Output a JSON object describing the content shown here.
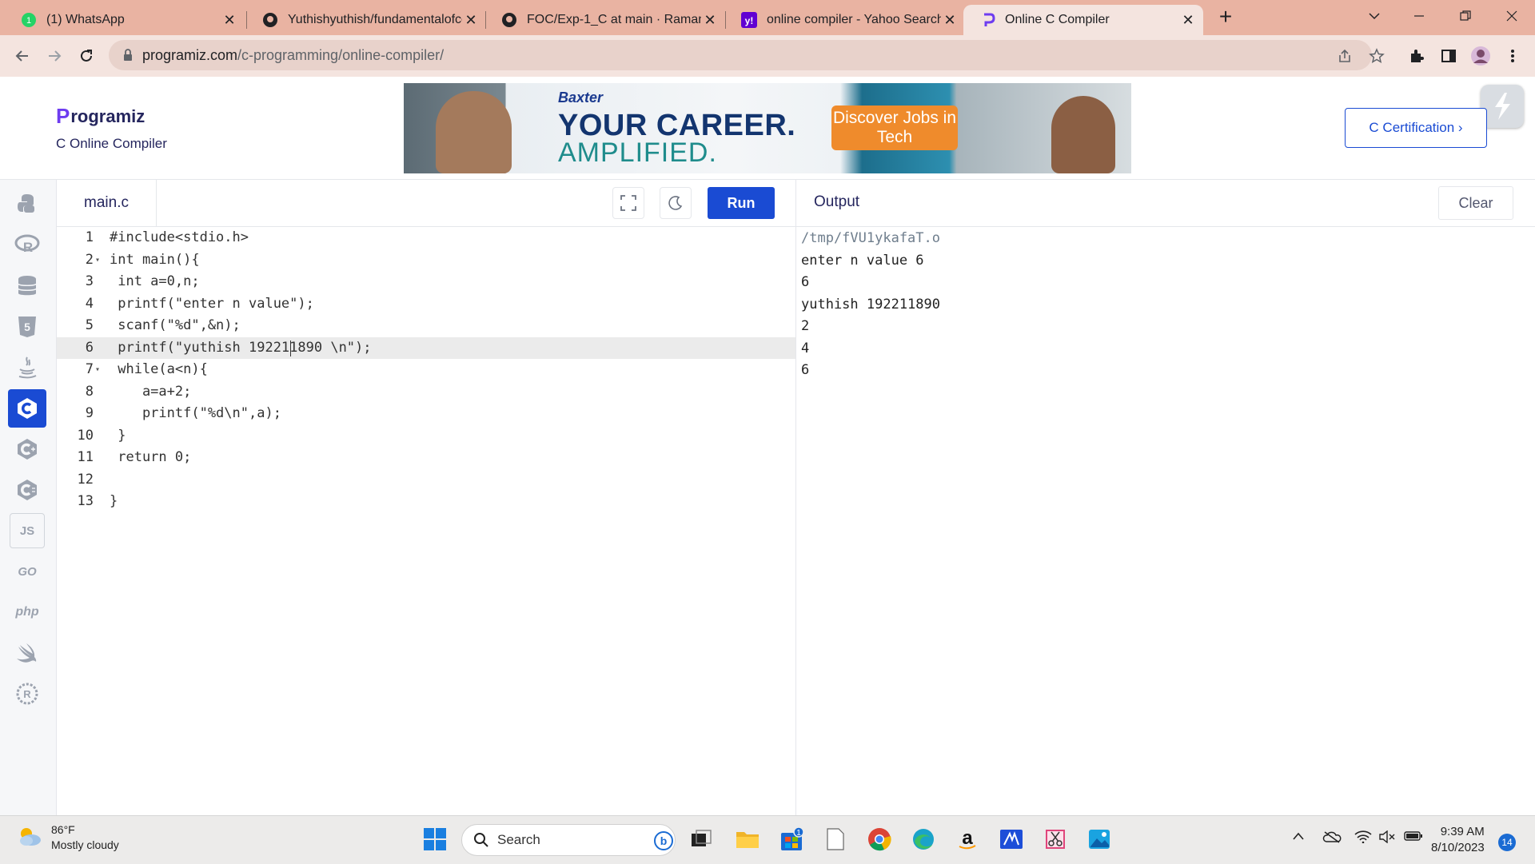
{
  "browser": {
    "tabs": [
      {
        "title": "(1) WhatsApp",
        "icon": "whatsapp-icon"
      },
      {
        "title": "Yuthishyuthish/fundamentalofcor",
        "icon": "github-icon"
      },
      {
        "title": "FOC/Exp-1_C at main · Ramanee:",
        "icon": "github-icon"
      },
      {
        "title": "online compiler - Yahoo Search R",
        "icon": "yahoo-icon"
      },
      {
        "title": "Online C Compiler",
        "icon": "programiz-icon",
        "active": true
      }
    ],
    "url_host": "programiz.com",
    "url_path": "/c-programming/online-compiler/"
  },
  "header": {
    "logo": "rogramiz",
    "logo_p": "P",
    "subtitle": "C Online Compiler",
    "ad": {
      "brand": "Baxter",
      "line1": "YOUR CAREER.",
      "line2": "AMPLIFIED.",
      "cta": "Discover Jobs in Tech"
    },
    "cert_button": "C Certification ›"
  },
  "sidebar": {
    "languages": [
      "python",
      "r",
      "sql",
      "html",
      "java",
      "c",
      "cpp",
      "csharp",
      "js",
      "go",
      "php",
      "swift",
      "rust"
    ],
    "labels": {
      "js": "JS",
      "go": "GO",
      "php": "php"
    }
  },
  "editor": {
    "filename": "main.c",
    "run_label": "Run",
    "lines": [
      "#include<stdio.h>",
      "int main(){",
      " int a=0,n;",
      " printf(\"enter n value\");",
      " scanf(\"%d\",&n);",
      " printf(\"yuthish 192211890 \\n\");",
      " while(a<n){",
      "    a=a+2;",
      "    printf(\"%d\\n\",a);",
      " }",
      " return 0;",
      "",
      "}"
    ],
    "line_numbers": [
      "1",
      "2",
      "3",
      "4",
      "5",
      "6",
      "7",
      "8",
      "9",
      "10",
      "11",
      "12",
      "13"
    ],
    "current_line": 6
  },
  "output": {
    "title": "Output",
    "clear_label": "Clear",
    "lines": [
      "/tmp/fVU1ykafaT.o",
      "enter n value 6",
      "6",
      "yuthish 192211890",
      "2",
      "4",
      "6"
    ]
  },
  "taskbar": {
    "weather_temp": "86°F",
    "weather_desc": "Mostly cloudy",
    "search_label": "Search",
    "store_badge": "1",
    "time": "9:39 AM",
    "date": "8/10/2023",
    "notifications": "14"
  },
  "colors": {
    "accent": "#1a4bd3",
    "tabbar": "#e9b3a2",
    "addressbar": "#f4e4df"
  }
}
